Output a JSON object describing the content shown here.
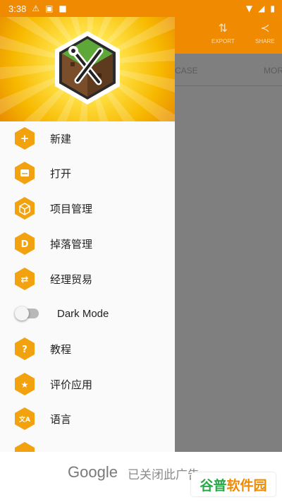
{
  "status_bar": {
    "time": "3:38"
  },
  "app_bar": {
    "export_label": "EXPORT",
    "share_label": "SHARE",
    "tabs": [
      "CASE",
      "MOR"
    ]
  },
  "drawer": {
    "items": [
      {
        "label": "新建",
        "icon": "plus-icon",
        "glyph": "+"
      },
      {
        "label": "打开",
        "icon": "open-folder-icon",
        "glyph": "▬"
      },
      {
        "label": "项目管理",
        "icon": "cube-icon",
        "glyph": "◈"
      },
      {
        "label": "掉落管理",
        "icon": "letter-d-icon",
        "glyph": "D"
      },
      {
        "label": "经理贸易",
        "icon": "swap-arrows-icon",
        "glyph": "⇄"
      },
      {
        "label": "Dark Mode",
        "icon": "toggle-switch",
        "glyph": ""
      },
      {
        "label": "教程",
        "icon": "help-icon",
        "glyph": "?"
      },
      {
        "label": "评价应用",
        "icon": "star-icon",
        "glyph": "★"
      },
      {
        "label": "语言",
        "icon": "translate-icon",
        "glyph": "文A"
      }
    ],
    "dark_mode_on": false
  },
  "ad_bar": {
    "brand": "Google",
    "close_text": "已关闭此广告"
  },
  "watermark": {
    "part1": "谷普",
    "part2": "软件园"
  },
  "colors": {
    "accent": "#f08a00",
    "hex_icon": "#f2a20f"
  }
}
